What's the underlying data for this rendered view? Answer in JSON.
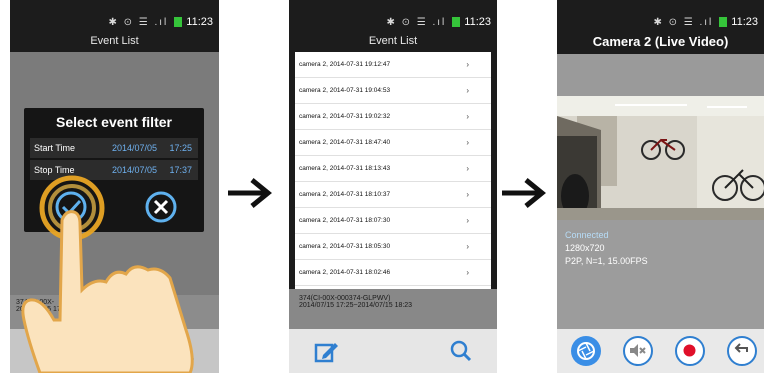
{
  "status_bar": {
    "time": "11:23",
    "icons": "✱ ⊙ ☰ .ıl",
    "battery": "84%"
  },
  "screen1": {
    "title": "Event List",
    "dialog": {
      "title": "Select event filter",
      "start_label": "Start Time",
      "start_date": "2014/07/05",
      "start_time": "17:25",
      "stop_label": "Stop Time",
      "stop_date": "2014/07/05",
      "stop_time": "17:37"
    },
    "info_line1": "374(CI-00X-",
    "info_line2": "2014/07/15 17:1"
  },
  "screen2": {
    "title": "Event List",
    "events": [
      "camera 2, 2014-07-31 19:12:47",
      "camera 2, 2014-07-31 19:04:53",
      "camera 2, 2014-07-31 19:02:32",
      "camera 2, 2014-07-31 18:47:40",
      "camera 2, 2014-07-31 18:13:43",
      "camera 2, 2014-07-31 18:10:37",
      "camera 2, 2014-07-31 18:07:30",
      "camera 2, 2014-07-31 18:05:30",
      "camera 2, 2014-07-31 18:02:46"
    ],
    "info_line1": "374(CI-00X-000374-GLPWV)",
    "info_line2": "2014/07/15 17:25~2014/07/15 18:23"
  },
  "screen3": {
    "title": "Camera 2 (Live Video)",
    "status": "Connected",
    "resolution": "1280x720",
    "stream": "P2P, N=1, 15.00FPS"
  },
  "colors": {
    "accent": "#2f7fd0",
    "record": "#e0102a",
    "connected": "#b7dcf7"
  }
}
